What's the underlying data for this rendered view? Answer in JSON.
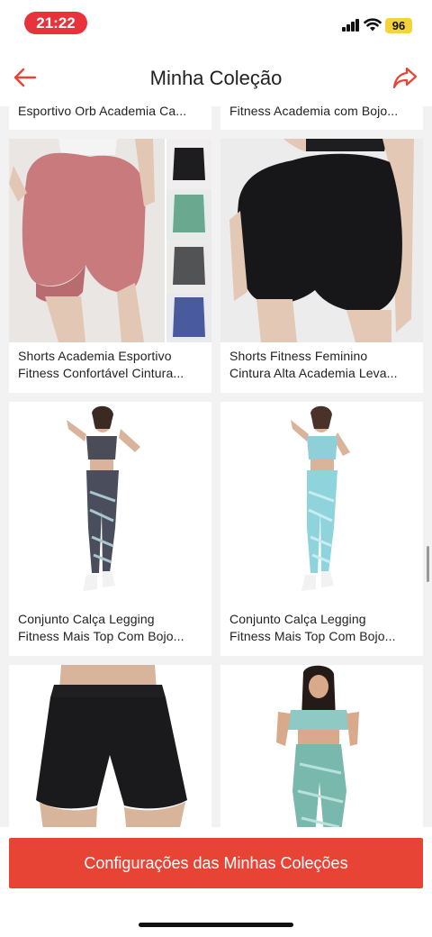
{
  "status_bar": {
    "time": "21:22",
    "battery": "96"
  },
  "header": {
    "title": "Minha Coleção",
    "back_icon": "arrow-left-icon",
    "share_icon": "share-arrow-icon"
  },
  "partial_top": [
    {
      "title_line": "Esportivo Orb Academia Ca..."
    },
    {
      "title_line": "Fitness Academia com Bojo..."
    }
  ],
  "products": [
    {
      "line1": "Shorts Academia Esportivo",
      "line2": "Fitness Confortável Cintura..."
    },
    {
      "line1": "Shorts Fitness Feminino",
      "line2": "Cintura Alta Academia Leva..."
    },
    {
      "line1": "Conjunto Calça Legging",
      "line2": "Fitness Mais Top Com Bojo..."
    },
    {
      "line1": "Conjunto Calça Legging",
      "line2": "Fitness Mais Top Com Bojo..."
    }
  ],
  "footer": {
    "button_label": "Configurações das Minhas Coleções"
  },
  "colors": {
    "accent": "#e84436",
    "time_pill": "#e8333c",
    "battery": "#f6d33a",
    "background": "#f2f2f2"
  }
}
